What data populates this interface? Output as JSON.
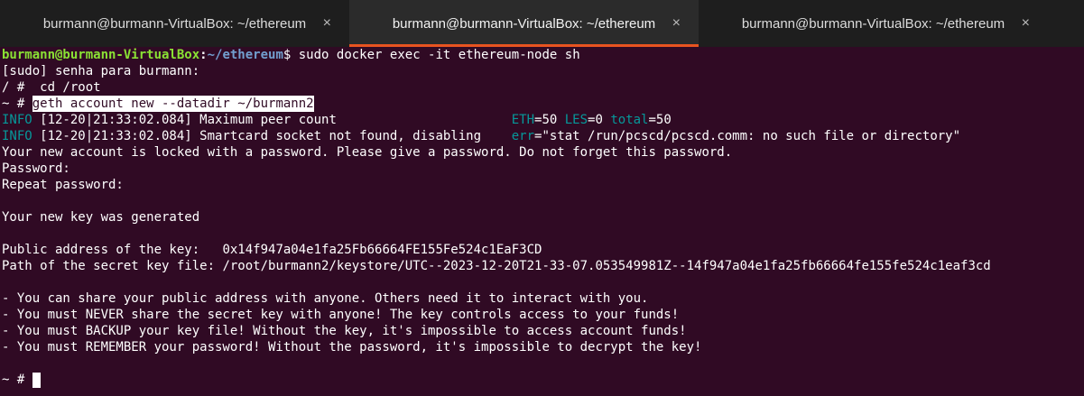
{
  "tabs": [
    {
      "title": "burmann@burmann-VirtualBox: ~/ethereum",
      "active": false
    },
    {
      "title": "burmann@burmann-VirtualBox: ~/ethereum",
      "active": true
    },
    {
      "title": "burmann@burmann-VirtualBox: ~/ethereum",
      "active": false
    }
  ],
  "tab_close_glyph": "×",
  "colors": {
    "background": "#300a24",
    "prompt_user": "#8ae234",
    "prompt_path": "#729fcf",
    "log_level": "#06989a",
    "active_tab_accent": "#e95420"
  },
  "terminal": {
    "prompt": {
      "user_host": "burmann@burmann-VirtualBox",
      "sep": ":",
      "path": "~/ethereum",
      "symbol": "$",
      "command": " sudo docker exec -it ethereum-node sh"
    },
    "sudo_line": "[sudo] senha para burmann:",
    "cd_prompt": "/ # ",
    "cd_command": " cd /root",
    "geth_prompt": "~ # ",
    "geth_command": "geth account new --datadir ~/burmann2",
    "log1": {
      "level": "INFO",
      "message": " [12-20|21:33:02.084] Maximum peer count                       ",
      "k1": "ETH",
      "v1": "=50 ",
      "k2": "LES",
      "v2": "=0 ",
      "k3": "total",
      "v3": "=50"
    },
    "log2": {
      "level": "INFO",
      "message": " [12-20|21:33:02.084] Smartcard socket not found, disabling    ",
      "k1": "err",
      "v1": "=\"stat /run/pcscd/pcscd.comm: no such file or directory\""
    },
    "locked_msg": "Your new account is locked with a password. Please give a password. Do not forget this password.",
    "password": "Password:",
    "repeat_password": "Repeat password:",
    "key_generated": "Your new key was generated",
    "public_address_label": "Public address of the key:   ",
    "public_address": "0x14f947a04e1fa25Fb66664FE155Fe524c1EaF3CD",
    "secret_path_label": "Path of the secret key file: ",
    "secret_path": "/root/burmann2/keystore/UTC--2023-12-20T21-33-07.053549981Z--14f947a04e1fa25fb66664fe155fe524c1eaf3cd",
    "notes": [
      "- You can share your public address with anyone. Others need it to interact with you.",
      "- You must NEVER share the secret key with anyone! The key controls access to your funds!",
      "- You must BACKUP your key file! Without the key, it's impossible to access account funds!",
      "- You must REMEMBER your password! Without the password, it's impossible to decrypt the key!"
    ],
    "final_prompt": "~ # "
  }
}
